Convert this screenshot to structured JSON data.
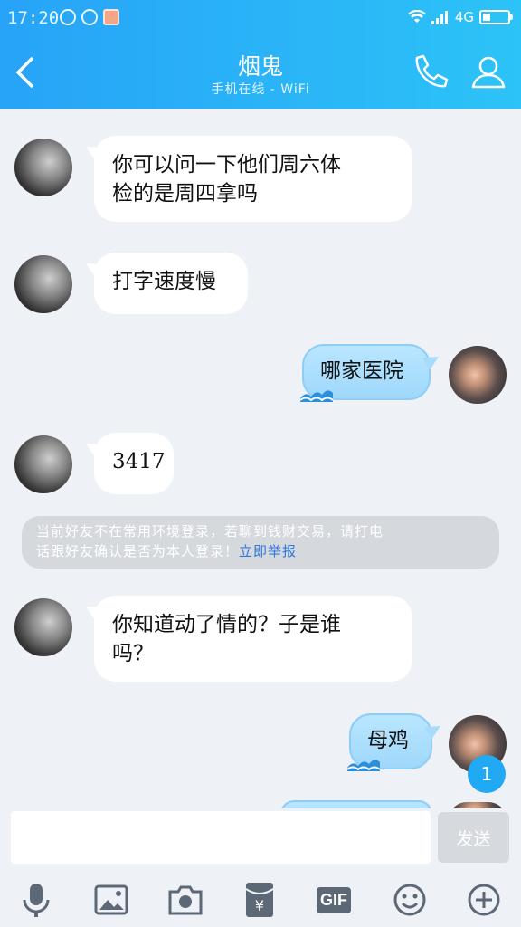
{
  "status": {
    "time": "17:20",
    "network": "4G",
    "battery": 0.3
  },
  "header": {
    "title": "烟鬼",
    "subtitle": "手机在线 - WiFi"
  },
  "messages": [
    {
      "from": "friend",
      "text_line1": "你可以问一下他们周六体",
      "text_line2": "检的是周四拿吗"
    },
    {
      "from": "friend",
      "text": "打字速度慢"
    },
    {
      "from": "me",
      "text": "哪家医院"
    },
    {
      "from": "friend",
      "text": "3417"
    },
    {
      "from": "friend",
      "text_line1": "你知道动了情的？子是谁",
      "text_line2": "吗？"
    },
    {
      "from": "me",
      "text": "母鸡"
    }
  ],
  "notice": {
    "line1": "当前好友不在常用环境登录，若聊到钱财交易，请打电",
    "line2": "话跟好友确认是否为本人登录！",
    "link": "立即举报"
  },
  "unread_count": "1",
  "input": {
    "placeholder": "",
    "send_label": "发送"
  },
  "toolbar": [
    "mic-icon",
    "image-icon",
    "camera-icon",
    "red-packet-icon",
    "gif-icon",
    "emoji-icon",
    "plus-icon"
  ],
  "toolbar_gif_label": "GIF",
  "colors": {
    "header_start": "#27a3f7",
    "header_end": "#2cc3f7",
    "my_bubble": "#a6dbfb",
    "link": "#2f78e0"
  }
}
